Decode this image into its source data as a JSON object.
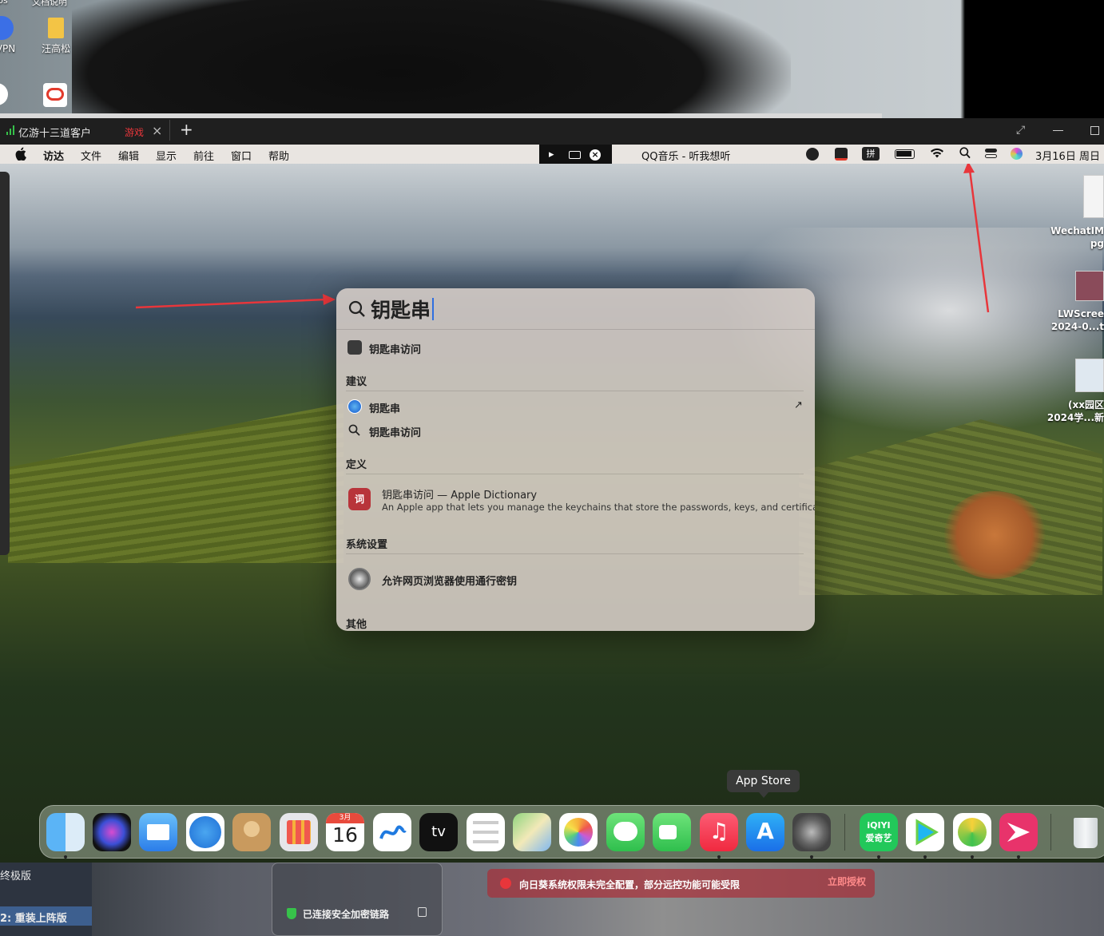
{
  "host_desktop": {
    "top_labels": [
      "ips",
      "文档说明"
    ],
    "icons": [
      {
        "label": "VPN"
      },
      {
        "label": "汪高松"
      }
    ]
  },
  "remote_window": {
    "app_tab_label": "亿游十三道客户",
    "tab_label": "游戏",
    "add_tab": "+"
  },
  "mac_menubar": {
    "apple": "",
    "items": [
      "访达",
      "文件",
      "编辑",
      "显示",
      "前往",
      "窗口",
      "帮助"
    ],
    "now_playing": "QQ音乐 - 听我想听",
    "date": "3月16日 周日"
  },
  "desktop_files": [
    {
      "line1": "WechatIM",
      "line2": "pg"
    },
    {
      "line1": "LWScree",
      "line2": "2024-0...t"
    },
    {
      "line1": "(xx园区",
      "line2": "2024学...新"
    }
  ],
  "spotlight": {
    "query": "钥匙串",
    "top_hit": "钥匙串访问",
    "sections": {
      "suggestions": "建议",
      "definition": "定义",
      "settings": "系统设置",
      "other": "其他"
    },
    "suggestions": [
      {
        "label": "钥匙串",
        "icon": "safari-icon",
        "arrow": "↗"
      },
      {
        "label": "钥匙串访问",
        "icon": "search-icon"
      }
    ],
    "definition": {
      "title": "钥匙串访问 — Apple Dictionary",
      "body": "An Apple app that lets you manage the keychains that store the passwords, keys, and certifica...",
      "icon_char": "词"
    },
    "setting_item": "允许网页浏览器使用通行密钥"
  },
  "dock": {
    "tooltip": "App Store",
    "calendar_month": "3月",
    "calendar_day": "16",
    "tv_label": "tv",
    "iqiyi_label": "iQIYI\n爱奇艺",
    "apps": [
      "finder",
      "siri",
      "mail",
      "safari",
      "contacts",
      "launchpad",
      "calendar",
      "freeform",
      "apple-tv",
      "reminders",
      "maps",
      "photos",
      "messages",
      "facetime",
      "music",
      "app-store",
      "system-settings",
      "iqiyi",
      "video-player",
      "qq-music",
      "flash",
      "trash"
    ]
  },
  "host_bottom": {
    "panel_line1": "终极版",
    "panel_line2": "2: 重装上阵版",
    "secure_text": "已连接安全加密链路",
    "alert_text": "向日葵系统权限未完全配置，部分远控功能可能受限",
    "alert_action": "立即授权"
  },
  "colors": {
    "accent_red": "#e8363b",
    "caret_blue": "#2f6fe0",
    "green_signal": "#37c24a"
  }
}
